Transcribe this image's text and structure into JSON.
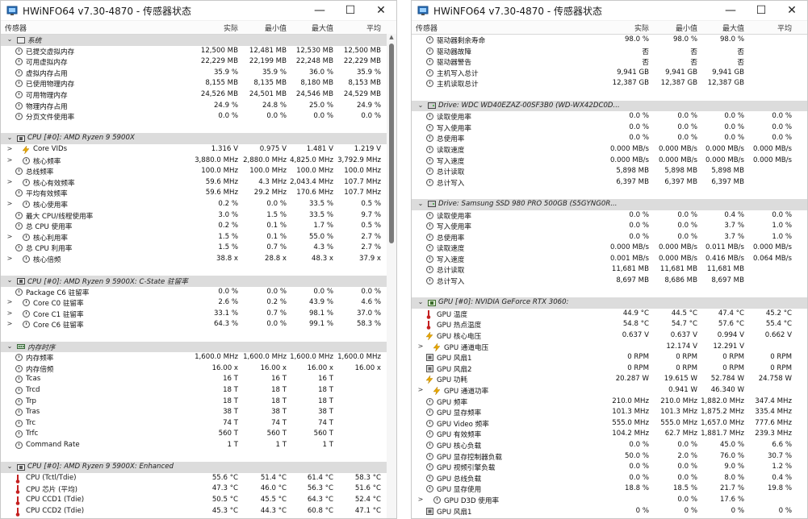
{
  "windows": [
    {
      "title": "HWiNFO64 v7.30-4870 - 传感器状态",
      "columns": [
        "传感器",
        "实际",
        "最小值",
        "最大值",
        "平均"
      ],
      "scroll": {
        "thumb_top": 0.0,
        "thumb_size": 0.42
      },
      "rows": [
        {
          "t": "group",
          "icon": "plain",
          "label": "系统"
        },
        {
          "t": "data",
          "icon": "clock",
          "label": "已提交虚拟内存",
          "v": [
            "12,500 MB",
            "12,481 MB",
            "12,530 MB",
            "12,500 MB"
          ]
        },
        {
          "t": "data",
          "icon": "clock",
          "label": "可用虚拟内存",
          "v": [
            "22,229 MB",
            "22,199 MB",
            "22,248 MB",
            "22,229 MB"
          ]
        },
        {
          "t": "data",
          "icon": "clock",
          "label": "虚拟内存占用",
          "v": [
            "35.9 %",
            "35.9 %",
            "36.0 %",
            "35.9 %"
          ]
        },
        {
          "t": "data",
          "icon": "clock",
          "label": "已使用物理内存",
          "v": [
            "8,155 MB",
            "8,135 MB",
            "8,180 MB",
            "8,153 MB"
          ]
        },
        {
          "t": "data",
          "icon": "clock",
          "label": "可用物理内存",
          "v": [
            "24,526 MB",
            "24,501 MB",
            "24,546 MB",
            "24,529 MB"
          ]
        },
        {
          "t": "data",
          "icon": "clock",
          "label": "物理内存占用",
          "v": [
            "24.9 %",
            "24.8 %",
            "25.0 %",
            "24.9 %"
          ]
        },
        {
          "t": "data",
          "icon": "clock",
          "label": "分页文件使用率",
          "v": [
            "0.0 %",
            "0.0 %",
            "0.0 %",
            "0.0 %"
          ]
        },
        {
          "t": "spacer"
        },
        {
          "t": "group",
          "icon": "cpu",
          "label": "CPU [#0]: AMD Ryzen 9 5900X"
        },
        {
          "t": "data",
          "exp": ">",
          "icon": "bolt",
          "label": "Core VIDs",
          "indent": 1,
          "v": [
            "1.316 V",
            "0.975 V",
            "1.481 V",
            "1.219 V"
          ]
        },
        {
          "t": "data",
          "exp": ">",
          "icon": "clock",
          "label": "核心频率",
          "indent": 1,
          "v": [
            "3,880.0 MHz",
            "2,880.0 MHz",
            "4,825.0 MHz",
            "3,792.9 MHz"
          ]
        },
        {
          "t": "data",
          "icon": "clock",
          "label": "总线频率",
          "v": [
            "100.0 MHz",
            "100.0 MHz",
            "100.0 MHz",
            "100.0 MHz"
          ]
        },
        {
          "t": "data",
          "exp": ">",
          "icon": "clock",
          "label": "核心有效频率",
          "indent": 1,
          "v": [
            "59.6 MHz",
            "4.3 MHz",
            "2,043.4 MHz",
            "107.7 MHz"
          ]
        },
        {
          "t": "data",
          "icon": "clock",
          "label": "平均有效频率",
          "v": [
            "59.6 MHz",
            "29.2 MHz",
            "170.6 MHz",
            "107.7 MHz"
          ]
        },
        {
          "t": "data",
          "exp": ">",
          "icon": "clock",
          "label": "核心使用率",
          "indent": 1,
          "v": [
            "0.2 %",
            "0.0 %",
            "33.5 %",
            "0.5 %"
          ]
        },
        {
          "t": "data",
          "icon": "clock",
          "label": "最大 CPU/线程使用率",
          "v": [
            "3.0 %",
            "1.5 %",
            "33.5 %",
            "9.7 %"
          ]
        },
        {
          "t": "data",
          "icon": "clock",
          "label": "总 CPU 使用率",
          "v": [
            "0.2 %",
            "0.1 %",
            "1.7 %",
            "0.5 %"
          ]
        },
        {
          "t": "data",
          "exp": ">",
          "icon": "clock",
          "label": "核心利用率",
          "indent": 1,
          "v": [
            "1.5 %",
            "0.1 %",
            "55.0 %",
            "2.7 %"
          ]
        },
        {
          "t": "data",
          "icon": "clock",
          "label": "总 CPU 利用率",
          "v": [
            "1.5 %",
            "0.7 %",
            "4.3 %",
            "2.7 %"
          ]
        },
        {
          "t": "data",
          "exp": ">",
          "icon": "clock",
          "label": "核心倍频",
          "indent": 1,
          "v": [
            "38.8 x",
            "28.8 x",
            "48.3 x",
            "37.9 x"
          ]
        },
        {
          "t": "spacer"
        },
        {
          "t": "group",
          "icon": "cpu",
          "label": "CPU [#0]: AMD Ryzen 9 5900X: C-State 驻留率"
        },
        {
          "t": "data",
          "icon": "clock",
          "label": "Package C6 驻留率",
          "v": [
            "0.0 %",
            "0.0 %",
            "0.0 %",
            "0.0 %"
          ]
        },
        {
          "t": "data",
          "exp": ">",
          "icon": "clock",
          "label": "Core C0 驻留率",
          "indent": 1,
          "v": [
            "2.6 %",
            "0.2 %",
            "43.9 %",
            "4.6 %"
          ]
        },
        {
          "t": "data",
          "exp": ">",
          "icon": "clock",
          "label": "Core C1 驻留率",
          "indent": 1,
          "v": [
            "33.1 %",
            "0.7 %",
            "98.1 %",
            "37.0 %"
          ]
        },
        {
          "t": "data",
          "exp": ">",
          "icon": "clock",
          "label": "Core C6 驻留率",
          "indent": 1,
          "v": [
            "64.3 %",
            "0.0 %",
            "99.1 %",
            "58.3 %"
          ]
        },
        {
          "t": "spacer"
        },
        {
          "t": "group",
          "icon": "mem",
          "label": "内存时序"
        },
        {
          "t": "data",
          "icon": "clock",
          "label": "内存频率",
          "v": [
            "1,600.0 MHz",
            "1,600.0 MHz",
            "1,600.0 MHz",
            "1,600.0 MHz"
          ]
        },
        {
          "t": "data",
          "icon": "clock",
          "label": "内存倍频",
          "v": [
            "16.00 x",
            "16.00 x",
            "16.00 x",
            "16.00 x"
          ]
        },
        {
          "t": "data",
          "icon": "clock",
          "label": "Tcas",
          "v": [
            "16 T",
            "16 T",
            "16 T",
            ""
          ]
        },
        {
          "t": "data",
          "icon": "clock",
          "label": "Trcd",
          "v": [
            "18 T",
            "18 T",
            "18 T",
            ""
          ]
        },
        {
          "t": "data",
          "icon": "clock",
          "label": "Trp",
          "v": [
            "18 T",
            "18 T",
            "18 T",
            ""
          ]
        },
        {
          "t": "data",
          "icon": "clock",
          "label": "Tras",
          "v": [
            "38 T",
            "38 T",
            "38 T",
            ""
          ]
        },
        {
          "t": "data",
          "icon": "clock",
          "label": "Trc",
          "v": [
            "74 T",
            "74 T",
            "74 T",
            ""
          ]
        },
        {
          "t": "data",
          "icon": "clock",
          "label": "Trfc",
          "v": [
            "560 T",
            "560 T",
            "560 T",
            ""
          ]
        },
        {
          "t": "data",
          "icon": "clock",
          "label": "Command Rate",
          "v": [
            "1 T",
            "1 T",
            "1 T",
            ""
          ]
        },
        {
          "t": "spacer"
        },
        {
          "t": "group",
          "icon": "cpu",
          "label": "CPU [#0]: AMD Ryzen 9 5900X: Enhanced"
        },
        {
          "t": "data",
          "icon": "therm",
          "label": "CPU (Tctl/Tdie)",
          "v": [
            "55.6 °C",
            "51.4 °C",
            "61.4 °C",
            "58.3 °C"
          ]
        },
        {
          "t": "data",
          "icon": "therm",
          "label": "CPU 芯片 (平均)",
          "v": [
            "47.3 °C",
            "46.0 °C",
            "56.3 °C",
            "51.6 °C"
          ]
        },
        {
          "t": "data",
          "icon": "therm",
          "label": "CPU CCD1 (Tdie)",
          "v": [
            "50.5 °C",
            "45.5 °C",
            "64.3 °C",
            "52.4 °C"
          ]
        },
        {
          "t": "data",
          "icon": "therm",
          "label": "CPU CCD2 (Tdie)",
          "v": [
            "45.3 °C",
            "44.3 °C",
            "60.8 °C",
            "47.1 °C"
          ]
        }
      ]
    },
    {
      "title": "HWiNFO64 v7.30-4870 - 传感器状态",
      "columns": [
        "传感器",
        "实际",
        "最小值",
        "最大值",
        "平均"
      ],
      "scroll": {
        "thumb_top": 0.0,
        "thumb_size": 0.0
      },
      "rows": [
        {
          "t": "data",
          "icon": "clock",
          "label": "驱动器剩余寿命",
          "v": [
            "98.0 %",
            "98.0 %",
            "98.0 %",
            ""
          ]
        },
        {
          "t": "data",
          "icon": "clock",
          "label": "驱动器故障",
          "v": [
            "否",
            "否",
            "否",
            ""
          ]
        },
        {
          "t": "data",
          "icon": "clock",
          "label": "驱动器警告",
          "v": [
            "否",
            "否",
            "否",
            ""
          ]
        },
        {
          "t": "data",
          "icon": "clock",
          "label": "主机写入总计",
          "v": [
            "9,941 GB",
            "9,941 GB",
            "9,941 GB",
            ""
          ]
        },
        {
          "t": "data",
          "icon": "clock",
          "label": "主机读取总计",
          "v": [
            "12,387 GB",
            "12,387 GB",
            "12,387 GB",
            ""
          ]
        },
        {
          "t": "spacer"
        },
        {
          "t": "group",
          "icon": "drive",
          "label": "Drive: WDC WD40EZAZ-00SF3B0 (WD-WX42DC0D..."
        },
        {
          "t": "data",
          "icon": "clock",
          "label": "读取使用率",
          "v": [
            "0.0 %",
            "0.0 %",
            "0.0 %",
            "0.0 %"
          ]
        },
        {
          "t": "data",
          "icon": "clock",
          "label": "写入使用率",
          "v": [
            "0.0 %",
            "0.0 %",
            "0.0 %",
            "0.0 %"
          ]
        },
        {
          "t": "data",
          "icon": "clock",
          "label": "总使用率",
          "v": [
            "0.0 %",
            "0.0 %",
            "0.0 %",
            "0.0 %"
          ]
        },
        {
          "t": "data",
          "icon": "clock",
          "label": "读取速度",
          "v": [
            "0.000 MB/s",
            "0.000 MB/s",
            "0.000 MB/s",
            "0.000 MB/s"
          ]
        },
        {
          "t": "data",
          "icon": "clock",
          "label": "写入速度",
          "v": [
            "0.000 MB/s",
            "0.000 MB/s",
            "0.000 MB/s",
            "0.000 MB/s"
          ]
        },
        {
          "t": "data",
          "icon": "clock",
          "label": "总计读取",
          "v": [
            "5,898 MB",
            "5,898 MB",
            "5,898 MB",
            ""
          ]
        },
        {
          "t": "data",
          "icon": "clock",
          "label": "总计写入",
          "v": [
            "6,397 MB",
            "6,397 MB",
            "6,397 MB",
            ""
          ]
        },
        {
          "t": "spacer"
        },
        {
          "t": "group",
          "icon": "drive",
          "label": "Drive: Samsung SSD 980 PRO 500GB (S5GYNG0R..."
        },
        {
          "t": "data",
          "icon": "clock",
          "label": "读取使用率",
          "v": [
            "0.0 %",
            "0.0 %",
            "0.4 %",
            "0.0 %"
          ]
        },
        {
          "t": "data",
          "icon": "clock",
          "label": "写入使用率",
          "v": [
            "0.0 %",
            "0.0 %",
            "3.7 %",
            "1.0 %"
          ]
        },
        {
          "t": "data",
          "icon": "clock",
          "label": "总使用率",
          "v": [
            "0.0 %",
            "0.0 %",
            "3.7 %",
            "1.0 %"
          ]
        },
        {
          "t": "data",
          "icon": "clock",
          "label": "读取速度",
          "v": [
            "0.000 MB/s",
            "0.000 MB/s",
            "0.011 MB/s",
            "0.000 MB/s"
          ]
        },
        {
          "t": "data",
          "icon": "clock",
          "label": "写入速度",
          "v": [
            "0.001 MB/s",
            "0.000 MB/s",
            "0.416 MB/s",
            "0.064 MB/s"
          ]
        },
        {
          "t": "data",
          "icon": "clock",
          "label": "总计读取",
          "v": [
            "11,681 MB",
            "11,681 MB",
            "11,681 MB",
            ""
          ]
        },
        {
          "t": "data",
          "icon": "clock",
          "label": "总计写入",
          "v": [
            "8,697 MB",
            "8,686 MB",
            "8,697 MB",
            ""
          ]
        },
        {
          "t": "spacer"
        },
        {
          "t": "group",
          "icon": "gpuchip",
          "label": "GPU [#0]: NVIDIA GeForce RTX 3060:"
        },
        {
          "t": "data",
          "icon": "therm",
          "label": "GPU 温度",
          "v": [
            "44.9 °C",
            "44.5 °C",
            "47.4 °C",
            "45.2 °C"
          ]
        },
        {
          "t": "data",
          "icon": "therm",
          "label": "GPU 热点温度",
          "v": [
            "54.8 °C",
            "54.7 °C",
            "57.6 °C",
            "55.4 °C"
          ]
        },
        {
          "t": "data",
          "icon": "bolt",
          "label": "GPU 核心电压",
          "v": [
            "0.637 V",
            "0.637 V",
            "0.994 V",
            "0.662 V"
          ]
        },
        {
          "t": "data",
          "exp": ">",
          "icon": "bolt",
          "label": "GPU 通道电压",
          "indent": 1,
          "v": [
            "",
            "12.174 V",
            "12.291 V",
            ""
          ]
        },
        {
          "t": "data",
          "icon": "chip",
          "label": "GPU 风扇1",
          "v": [
            "0 RPM",
            "0 RPM",
            "0 RPM",
            "0 RPM"
          ]
        },
        {
          "t": "data",
          "icon": "chip",
          "label": "GPU 风扇2",
          "v": [
            "0 RPM",
            "0 RPM",
            "0 RPM",
            "0 RPM"
          ]
        },
        {
          "t": "data",
          "icon": "bolt",
          "label": "GPU 功耗",
          "v": [
            "20.287 W",
            "19.615 W",
            "52.784 W",
            "24.758 W"
          ]
        },
        {
          "t": "data",
          "exp": ">",
          "icon": "bolt",
          "label": "GPU 通道功率",
          "indent": 1,
          "v": [
            "",
            "0.941 W",
            "46.340 W",
            ""
          ]
        },
        {
          "t": "data",
          "icon": "clock",
          "label": "GPU 频率",
          "v": [
            "210.0 MHz",
            "210.0 MHz",
            "1,882.0 MHz",
            "347.4 MHz"
          ]
        },
        {
          "t": "data",
          "icon": "clock",
          "label": "GPU 显存频率",
          "v": [
            "101.3 MHz",
            "101.3 MHz",
            "1,875.2 MHz",
            "335.4 MHz"
          ]
        },
        {
          "t": "data",
          "icon": "clock",
          "label": "GPU Video 频率",
          "v": [
            "555.0 MHz",
            "555.0 MHz",
            "1,657.0 MHz",
            "777.6 MHz"
          ]
        },
        {
          "t": "data",
          "icon": "clock",
          "label": "GPU 有效频率",
          "v": [
            "104.2 MHz",
            "62.7 MHz",
            "1,881.7 MHz",
            "239.3 MHz"
          ]
        },
        {
          "t": "data",
          "icon": "clock",
          "label": "GPU 核心负载",
          "v": [
            "0.0 %",
            "0.0 %",
            "45.0 %",
            "6.6 %"
          ]
        },
        {
          "t": "data",
          "icon": "clock",
          "label": "GPU 显存控制器负载",
          "v": [
            "50.0 %",
            "2.0 %",
            "76.0 %",
            "30.7 %"
          ]
        },
        {
          "t": "data",
          "icon": "clock",
          "label": "GPU 视频引擎负载",
          "v": [
            "0.0 %",
            "0.0 %",
            "9.0 %",
            "1.2 %"
          ]
        },
        {
          "t": "data",
          "icon": "clock",
          "label": "GPU 总线负载",
          "v": [
            "0.0 %",
            "0.0 %",
            "8.0 %",
            "0.4 %"
          ]
        },
        {
          "t": "data",
          "icon": "clock",
          "label": "GPU 显存使用",
          "v": [
            "18.8 %",
            "18.5 %",
            "21.7 %",
            "19.8 %"
          ]
        },
        {
          "t": "data",
          "exp": ">",
          "icon": "clock",
          "label": "GPU D3D 使用率",
          "indent": 1,
          "v": [
            "",
            "0.0 %",
            "17.6 %",
            ""
          ]
        },
        {
          "t": "data",
          "icon": "chip",
          "label": "GPU 风扇1",
          "v": [
            "0 %",
            "0 %",
            "0 %",
            "0 %"
          ]
        }
      ]
    }
  ]
}
